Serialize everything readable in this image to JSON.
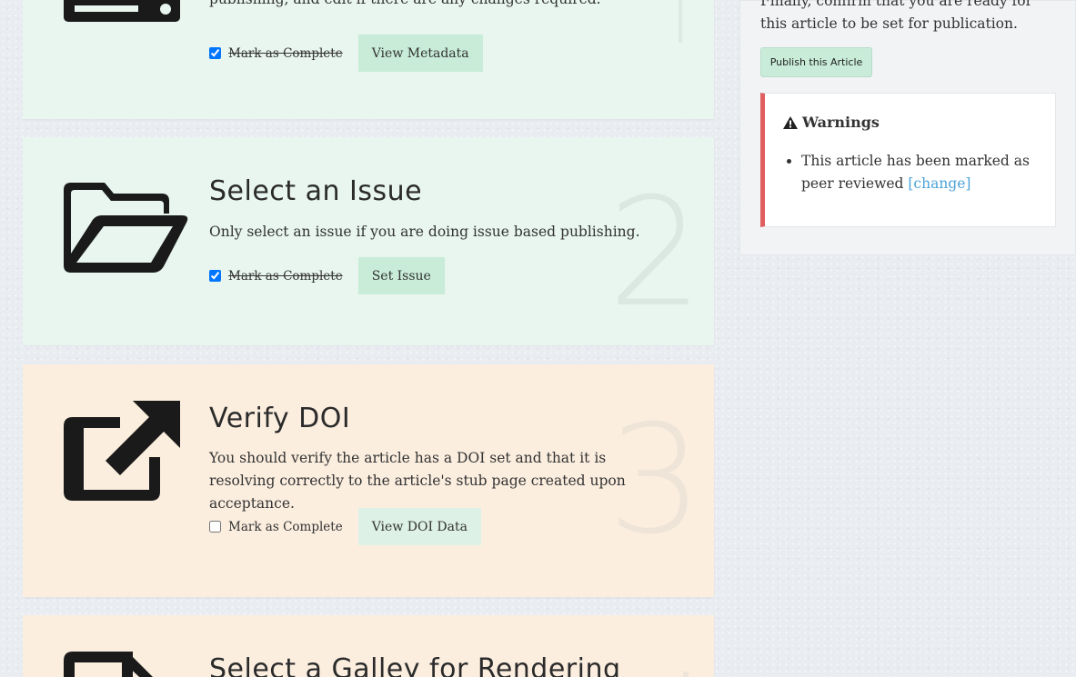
{
  "steps": [
    {
      "title": "",
      "description": "publishing, and edit if there are any changes required.",
      "complete_label": "Mark as Complete",
      "complete_checked": true,
      "action_label": "View Metadata",
      "icon": "server-icon"
    },
    {
      "number": "2",
      "title": "Select an Issue",
      "description": "Only select an issue if you are doing issue based publishing.",
      "complete_label": "Mark as Complete",
      "complete_checked": true,
      "action_label": "Set Issue",
      "icon": "folder-open-icon"
    },
    {
      "number": "3",
      "title": "Verify DOI",
      "description": "You should verify the article has a DOI set and that it is resolving correctly to the article's stub page created upon acceptance.",
      "complete_label": "Mark as Complete",
      "complete_checked": false,
      "action_label": "View DOI Data",
      "icon": "external-link-icon"
    },
    {
      "title": "Select a Galley for Rendering",
      "icon": "file-icon"
    }
  ],
  "sidebar": {
    "intro_text": "Finally, confirm that you are ready for this article to be set for publication.",
    "publish_button": "Publish this Article",
    "warnings": {
      "title": "Warnings",
      "icon": "warning-icon",
      "item_text": "This article has been marked as peer reviewed",
      "item_link": "[change]"
    }
  },
  "colors": {
    "complete_card": "#e8f6ef",
    "pending_card": "#fbeedf",
    "button": "#c8ecd8",
    "warning_border": "#e05e5e",
    "link": "#4ba3d9"
  }
}
